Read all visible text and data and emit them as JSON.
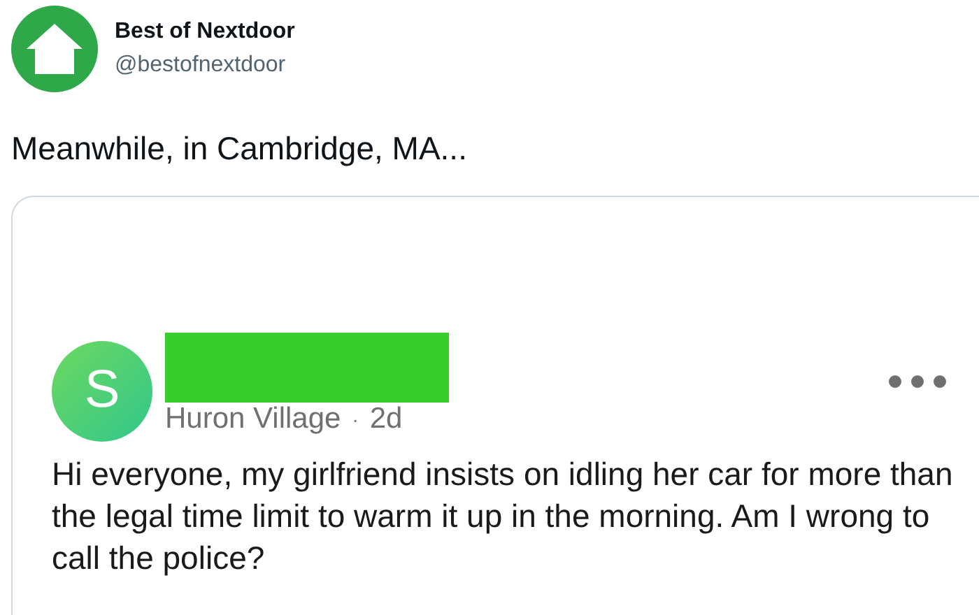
{
  "author": {
    "name": "Best of Nextdoor",
    "handle": "@bestofnextdoor"
  },
  "tweet_text": "Meanwhile, in Cambridge, MA...",
  "post": {
    "avatar_letter": "S",
    "name_redacted": true,
    "neighborhood": "Huron Village",
    "separator": "·",
    "time": "2d",
    "body": "Hi everyone, my girlfriend insists on idling her car for more than the legal time limit to warm it up in the morning. Am I wrong to call the police?"
  }
}
